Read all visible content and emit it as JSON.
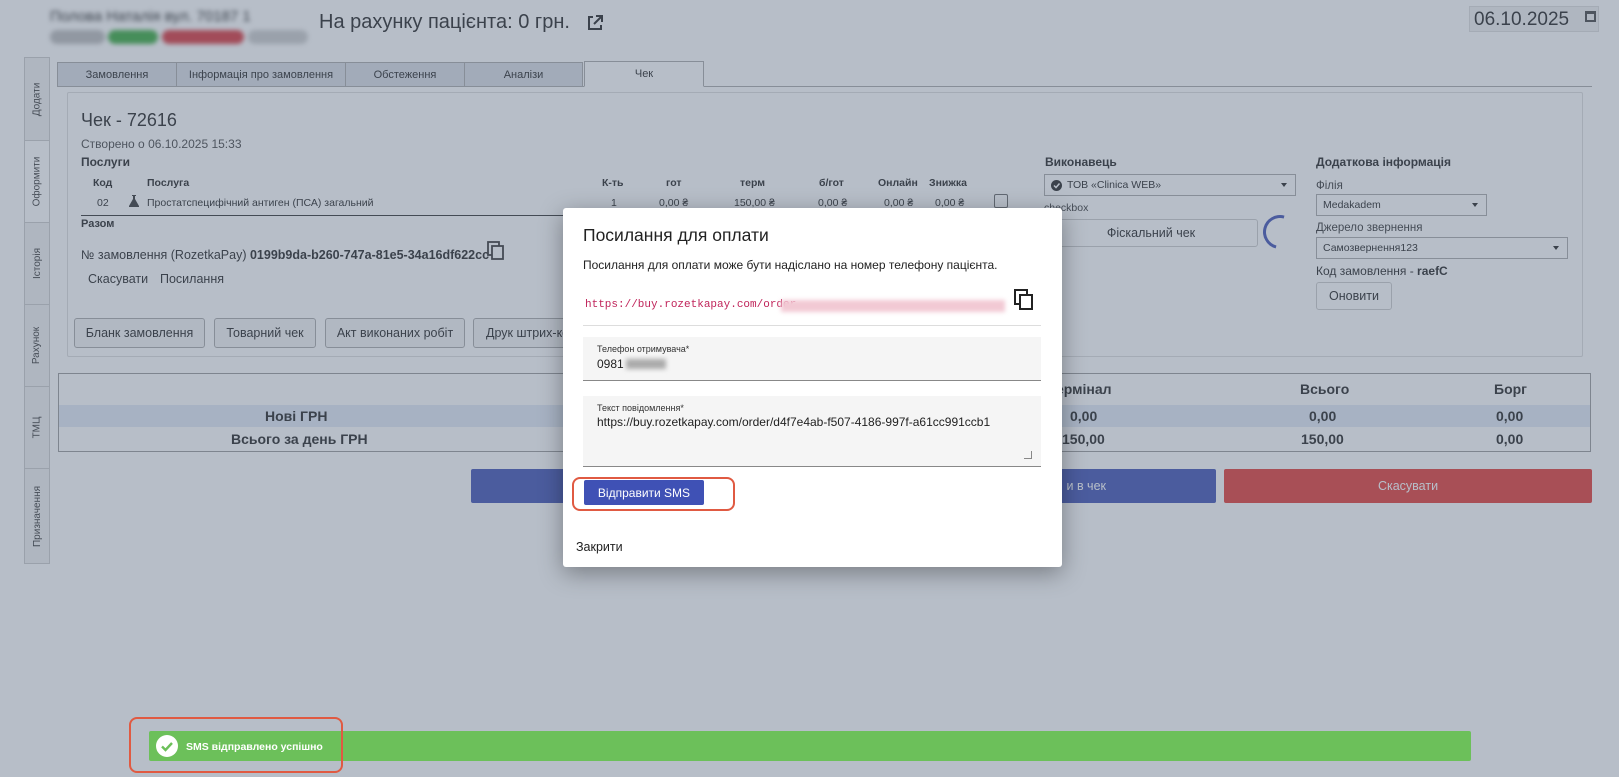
{
  "header": {
    "patient_name": "Полова Наталія вул. 70187 1",
    "balance": "На рахунку пацієнта: 0 грн.",
    "date": "06.10.2025"
  },
  "side_tabs": [
    "Додати",
    "Оформити",
    "Історія",
    "Рахунок",
    "ТМЦ",
    "Призначення"
  ],
  "tabs": [
    "Замовлення",
    "Інформація про замовлення",
    "Обстеження",
    "Аналізи",
    "Чек"
  ],
  "check": {
    "title": "Чек - 72616",
    "created": "Створено о 06.10.2025 15:33",
    "services_heading": "Послуги",
    "columns": [
      "Код",
      "Послуга",
      "К-ть",
      "гот",
      "терм",
      "б/гот",
      "Онлайн",
      "Знижка"
    ],
    "row": {
      "code": "02",
      "name": "Простатспецифічний антиген (ПСА) загальний",
      "qty": "1",
      "cash": "0,00 ₴",
      "terminal": "150,00 ₴",
      "noncash": "0,00 ₴",
      "online": "0,00 ₴",
      "discount": "0,00 ₴"
    },
    "total_label": "Разом",
    "order_label": "№ замовлення (RozetkaPay)",
    "order_id": "0199b9da-b260-747a-81e5-34a16df622cc",
    "cancel_link": "Скасувати",
    "link_link": "Посилання",
    "buttons": [
      "Бланк замовлення",
      "Товарний чек",
      "Акт виконаних робіт",
      "Друк штрих-ко"
    ]
  },
  "executor": {
    "heading": "Виконавець",
    "value": "ТОВ «Clinica WEB»",
    "checkbox_label": "checkbox",
    "fiscal_button": "Фіскальний чек"
  },
  "additional": {
    "heading": "Додаткова інформація",
    "branch_label": "Філія",
    "branch_value": "Medakadem",
    "source_label": "Джерело звернення",
    "source_value": "Самозвернення123",
    "code_label": "Код замовлення -",
    "code_value": "raefC",
    "refresh_button": "Оновити"
  },
  "stats": {
    "headers": [
      "ермінал",
      "Всього",
      "Борг"
    ],
    "rows": [
      {
        "label": "Нові ГРН",
        "terminal": "0,00",
        "total": "0,00",
        "debt": "0,00"
      },
      {
        "label": "Всього за день ГРН",
        "terminal": "150,00",
        "total": "150,00",
        "debt": "0,00"
      }
    ]
  },
  "actions": {
    "to_check": "и в чек",
    "cancel": "Скасувати"
  },
  "modal": {
    "title": "Посилання для оплати",
    "description": "Посилання для оплати може бути надіслано на номер телефону пацієнта.",
    "link": "https://buy.rozetkapay.com/order",
    "phone_label": "Телефон отримувача*",
    "phone_value": "0981",
    "message_label": "Текст повідомлення*",
    "message_value": "https://buy.rozetkapay.com/order/d4f7e4ab-f507-4186-997f-a61cc991ccb1",
    "send_button": "Відправити SMS",
    "close_button": "Закрити"
  },
  "snackbar": {
    "text": "SMS відправлено успішно"
  },
  "colors": {
    "primary": "#3f51b5",
    "danger": "#e53935",
    "success": "#6cc05a",
    "highlight": "#e05a42"
  }
}
